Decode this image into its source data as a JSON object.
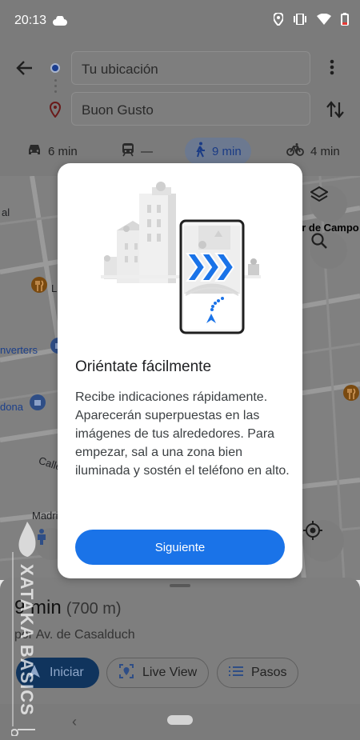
{
  "status": {
    "time": "20:13",
    "icons": [
      "cloud-icon",
      "location-icon",
      "vibrate-icon",
      "wifi-icon",
      "battery-icon"
    ]
  },
  "directions": {
    "origin": "Tu ubicación",
    "destination": "Buon Gusto",
    "modes": [
      {
        "icon": "car-icon",
        "label": "6 min"
      },
      {
        "icon": "transit-icon",
        "label": "—"
      },
      {
        "icon": "walk-icon",
        "label": "9 min",
        "active": true
      },
      {
        "icon": "bike-icon",
        "label": "4 min"
      }
    ]
  },
  "map": {
    "labels": {
      "left_l": "al",
      "campo": "er de Campo",
      "l_letter": "L",
      "converters": "nverters",
      "dona": "dona",
      "calle": "Calle",
      "madri": "Madri"
    }
  },
  "dialog": {
    "title": "Oriéntate fácilmente",
    "body": "Recibe indicaciones rápidamente. Aparecerán superpuestas en las imágenes de tus alrededores. Para empezar, sal a una zona bien iluminada y sostén el teléfono en alto.",
    "button": "Siguiente"
  },
  "sheet": {
    "duration": "9 min",
    "distance": "(700 m)",
    "via": "por Av. de Casalduch",
    "start": "Iniciar",
    "liveview": "Live View",
    "steps": "Pasos"
  },
  "watermark": {
    "text": "XATAKA BASICS"
  },
  "colors": {
    "primary": "#1a73e8",
    "scrim": "#7b7b7b"
  }
}
